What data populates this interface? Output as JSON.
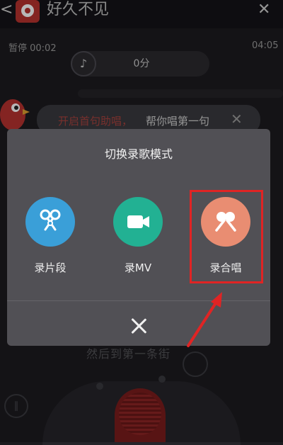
{
  "header": {
    "song_title": "好久不见",
    "back_glyph": "<",
    "close_glyph": "✕"
  },
  "player": {
    "paused_label": "暂停 00:02",
    "total_time": "04:05",
    "score": "0分"
  },
  "hint": {
    "part1": "开启首句助唱，",
    "part2": "帮你唱第一句"
  },
  "background_text": "然后到第一条街",
  "dialog": {
    "title": "切换录歌模式",
    "modes": [
      {
        "label": "录片段",
        "icon": "scissors-clip-icon",
        "color": "#3a9fd8"
      },
      {
        "label": "录MV",
        "icon": "video-camera-icon",
        "color": "#22b193"
      },
      {
        "label": "录合唱",
        "icon": "duet-microphone-icon",
        "color": "#e98d72"
      }
    ]
  },
  "colors": {
    "annotation_red": "#e02424",
    "dialog_bg": "#515055",
    "background": "#1c1b1f"
  }
}
